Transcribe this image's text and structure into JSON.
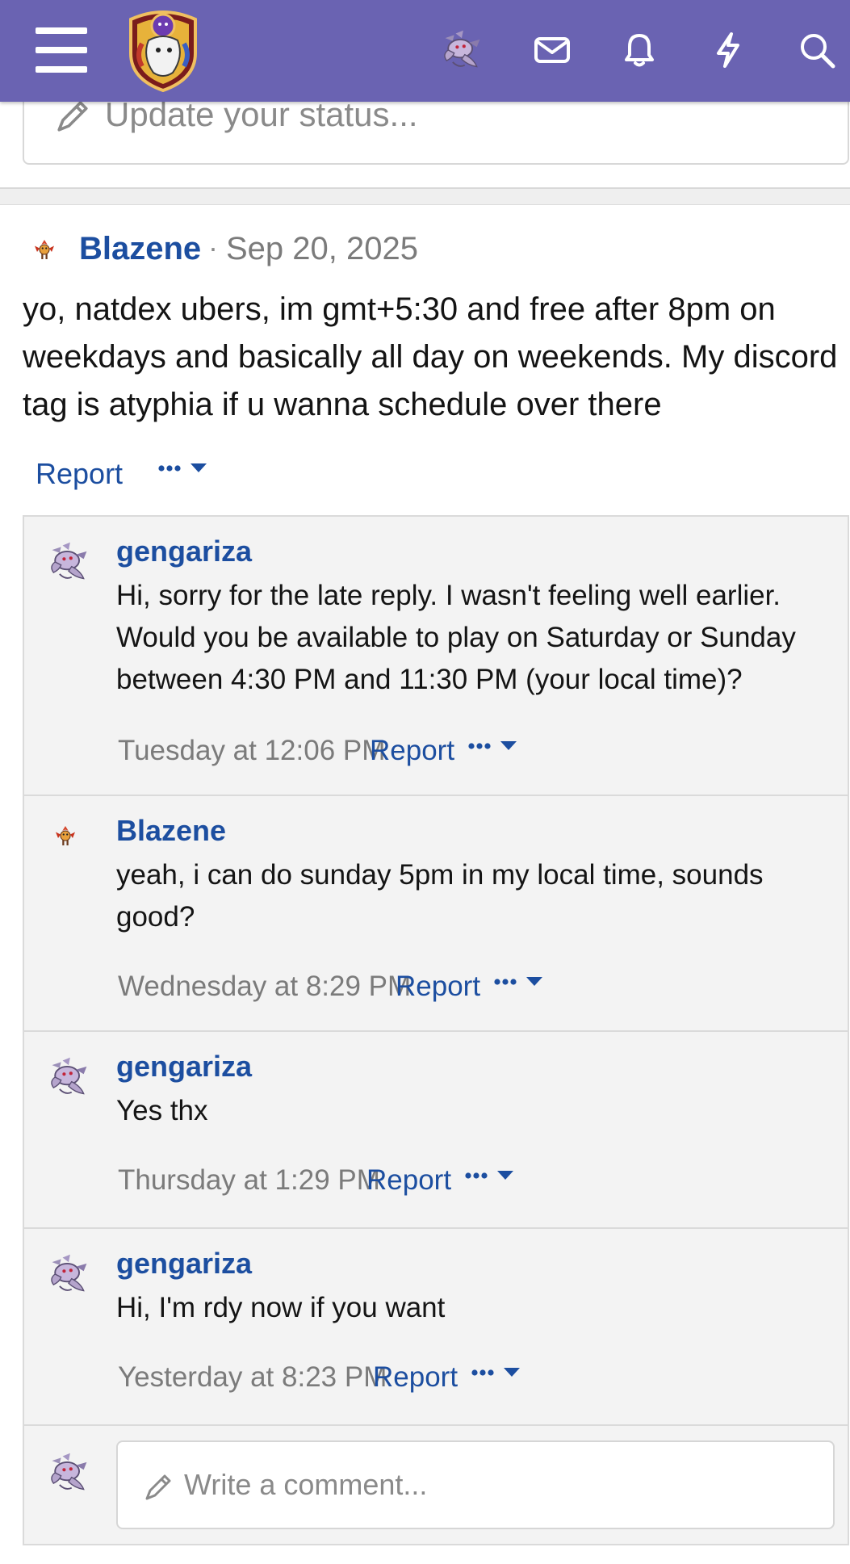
{
  "colors": {
    "header_bg": "#6a63b2",
    "link_blue": "#1c4ea0",
    "muted_gray": "#7b7b7b",
    "comment_bg": "#f3f3f3"
  },
  "header": {
    "icons": [
      "menu-icon",
      "site-logo",
      "user-avatar",
      "mail-icon",
      "bell-icon",
      "bolt-icon",
      "search-icon"
    ]
  },
  "status": {
    "placeholder": "Update your status..."
  },
  "post": {
    "author": "Blazene",
    "separator": "·",
    "date": "Sep 20, 2025",
    "body": "yo, natdex ubers, im gmt+5:30 and free after 8pm on weekdays and basically all day on weekends. My discord tag is atyphia if u wanna schedule over there",
    "report_label": "Report"
  },
  "comments": [
    {
      "author": "gengariza",
      "text": "Hi, sorry for the late reply. I wasn't feeling well earlier. Would you be available to play on Saturday or Sunday between 4:30 PM and 11:30 PM (your local time)?",
      "time": "Tuesday at 12:06 PM",
      "report_label": "Report"
    },
    {
      "author": "Blazene",
      "text": "yeah, i can do sunday 5pm in my local time, sounds good?",
      "time": "Wednesday at 8:29 PM",
      "report_label": "Report"
    },
    {
      "author": "gengariza",
      "text": "Yes thx",
      "time": "Thursday at 1:29 PM",
      "report_label": "Report"
    },
    {
      "author": "gengariza",
      "text": "Hi, I'm rdy now if you want",
      "time": "Yesterday at 8:23 PM",
      "report_label": "Report"
    }
  ],
  "compose": {
    "placeholder": "Write a comment..."
  }
}
